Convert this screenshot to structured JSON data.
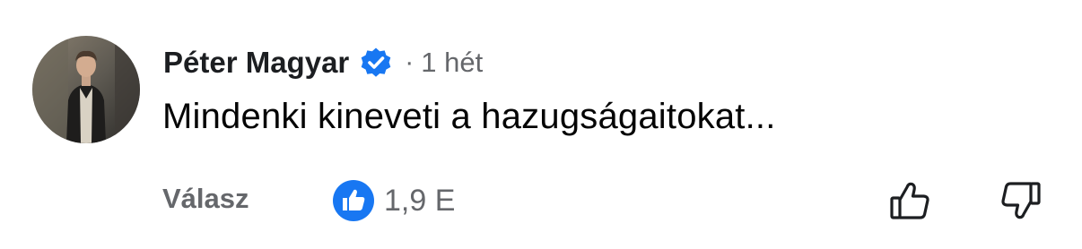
{
  "comment": {
    "author": "Péter Magyar",
    "separator": "·",
    "timestamp": "1 hét",
    "text": "Mindenki kineveti a hazugságaitokat...",
    "reply_label": "Válasz",
    "reaction_count": "1,9 E",
    "reaction_type": "like-icon",
    "verified_icon": "verified-badge-icon",
    "actions": [
      "thumbs-up-icon",
      "thumbs-down-icon"
    ]
  },
  "colors": {
    "accent_blue": "#1877f2",
    "secondary_text": "#65676b",
    "primary_text": "#050505"
  }
}
